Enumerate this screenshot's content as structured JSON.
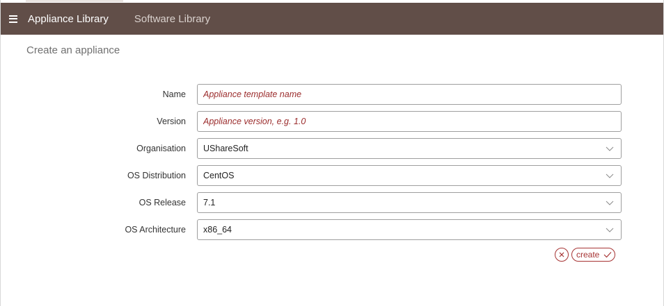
{
  "nav": {
    "menu_icon": "hamburger-menu-icon",
    "items": [
      {
        "label": "Appliance Library",
        "active": true
      },
      {
        "label": "Software Library",
        "active": false
      }
    ],
    "bar_color": "#614e48"
  },
  "page": {
    "title": "Create an appliance"
  },
  "form": {
    "name": {
      "label": "Name",
      "value": "",
      "placeholder": "Appliance template name"
    },
    "version": {
      "label": "Version",
      "value": "",
      "placeholder": "Appliance version, e.g. 1.0"
    },
    "organisation": {
      "label": "Organisation",
      "selected": "UShareSoft"
    },
    "os_distribution": {
      "label": "OS Distribution",
      "selected": "CentOS"
    },
    "os_release": {
      "label": "OS Release",
      "selected": "7.1"
    },
    "os_architecture": {
      "label": "OS Architecture",
      "selected": "x86_64"
    }
  },
  "actions": {
    "cancel_icon": "close-icon",
    "create_label": "create",
    "create_icon": "checkmark-icon",
    "accent_color": "#a63333"
  }
}
